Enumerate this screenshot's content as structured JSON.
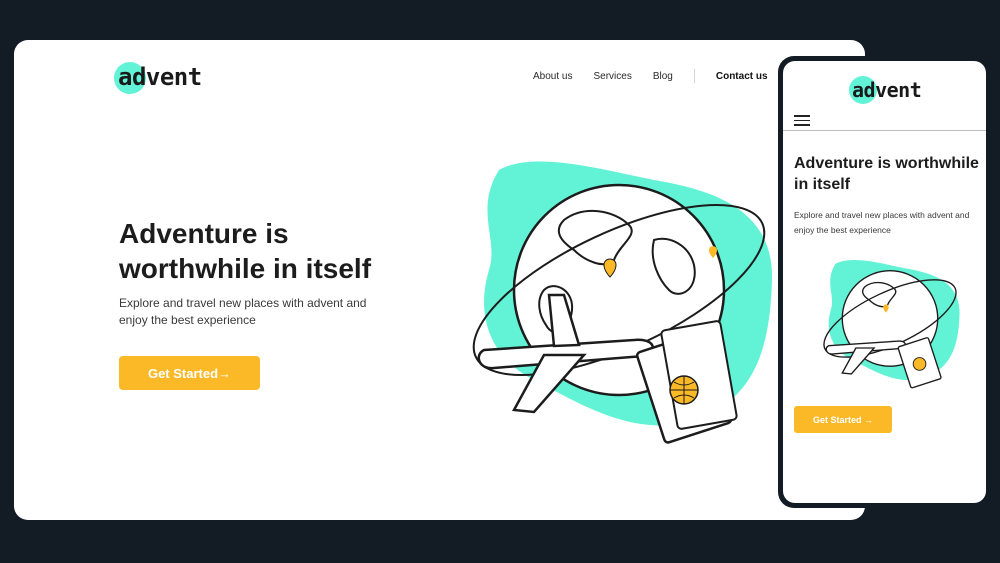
{
  "brand": {
    "name": "advent",
    "accent": "#62f3d6",
    "cta_color": "#fbb927",
    "background": "#131b24"
  },
  "nav": {
    "items": [
      "About us",
      "Services",
      "Blog"
    ],
    "contact": "Contact us"
  },
  "hero": {
    "title": "Adventure is worthwhile in itself",
    "subtitle": "Explore and travel new places with advent and enjoy the best experience",
    "cta": "Get Started→"
  },
  "mobile": {
    "title": "Adventure is worthwhile in itself",
    "subtitle": "Explore and travel new places with advent and enjoy the best experience",
    "cta": "Get Started →",
    "menu_icon": "hamburger-menu-icon"
  },
  "illustration": {
    "subject": "globe-airplane-passport-illustration",
    "pin_color": "#fbb927"
  }
}
